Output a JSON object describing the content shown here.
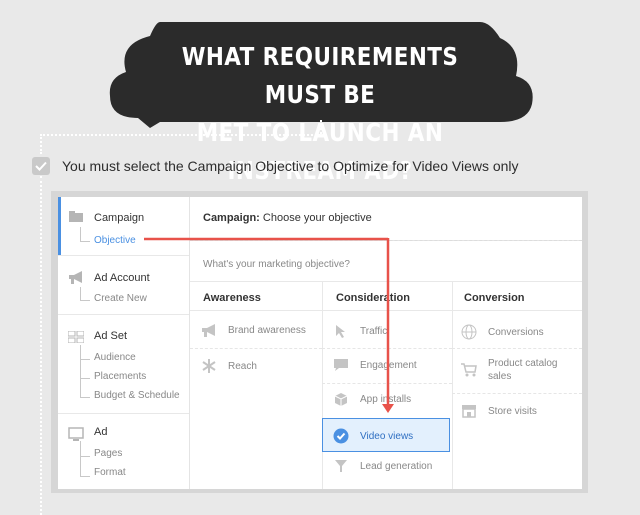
{
  "headline": {
    "line1": "WHAT REQUIREMENTS MUST BE",
    "line2": "MET TO LAUNCH AN INSTREAM AD?"
  },
  "requirement": {
    "checked": true,
    "text": "You must select the Campaign Objective to Optimize for Video Views only"
  },
  "sidebar": {
    "sections": [
      {
        "title": "Campaign",
        "icon": "folder-icon",
        "active": true,
        "items": [
          "Objective"
        ]
      },
      {
        "title": "Ad Account",
        "icon": "megaphone-icon",
        "items": [
          "Create New"
        ]
      },
      {
        "title": "Ad Set",
        "icon": "grid-icon",
        "items": [
          "Audience",
          "Placements",
          "Budget & Schedule"
        ]
      },
      {
        "title": "Ad",
        "icon": "monitor-icon",
        "items": [
          "Pages",
          "Format"
        ]
      }
    ]
  },
  "main": {
    "header_bold": "Campaign:",
    "header_text": " Choose your objective",
    "question": "What's your marketing objective?",
    "columns": [
      {
        "title": "Awareness",
        "options": [
          {
            "label": "Brand awareness",
            "icon": "megaphone-icon"
          },
          {
            "label": "Reach",
            "icon": "asterisk-icon"
          }
        ]
      },
      {
        "title": "Consideration",
        "options": [
          {
            "label": "Traffic",
            "icon": "cursor-icon"
          },
          {
            "label": "Engagement",
            "icon": "chat-icon"
          },
          {
            "label": "App installs",
            "icon": "box-icon"
          },
          {
            "label": "Video views",
            "icon": "check-circle-icon",
            "selected": true
          },
          {
            "label": "Lead generation",
            "icon": "funnel-icon"
          }
        ]
      },
      {
        "title": "Conversion",
        "options": [
          {
            "label": "Conversions",
            "icon": "globe-icon"
          },
          {
            "label": "Product catalog",
            "label2": "sales",
            "icon": "cart-icon"
          },
          {
            "label": "Store visits",
            "icon": "store-icon"
          }
        ]
      }
    ]
  },
  "colors": {
    "background": "#e9e9e9",
    "bubble": "#2b2b2b",
    "accent_red": "#e8524a",
    "accent_blue": "#4a90e2",
    "selected_bg": "#e3f0fd"
  }
}
